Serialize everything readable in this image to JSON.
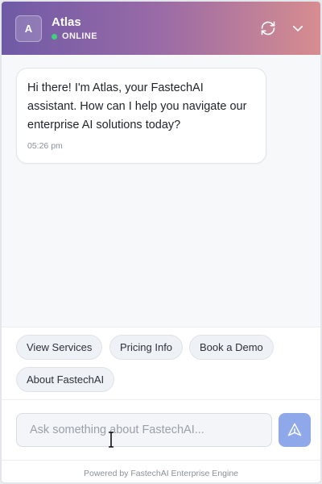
{
  "header": {
    "avatar_letter": "A",
    "bot_name": "Atlas",
    "status": "ONLINE",
    "status_color": "#3ed07a",
    "icons": [
      "refresh-icon",
      "chevron-down-icon"
    ]
  },
  "messages": [
    {
      "sender": "bot",
      "text": "Hi there! I'm Atlas, your FastechAI assistant. How can I help you navigate our enterprise AI solutions today?",
      "time": "05:26 pm"
    }
  ],
  "quick_replies": [
    {
      "label": "View Services"
    },
    {
      "label": "Pricing Info"
    },
    {
      "label": "Book a Demo"
    },
    {
      "label": "About FastechAI"
    }
  ],
  "input": {
    "value": "",
    "placeholder": "Ask something about FastechAI..."
  },
  "send_icon": "send-icon",
  "footer": "Powered by FastechAI Enterprise Engine",
  "colors": {
    "header_gradient_start": "#6f5aa6",
    "header_gradient_end": "#d78d8f",
    "send_button": "#8fa8ea"
  }
}
